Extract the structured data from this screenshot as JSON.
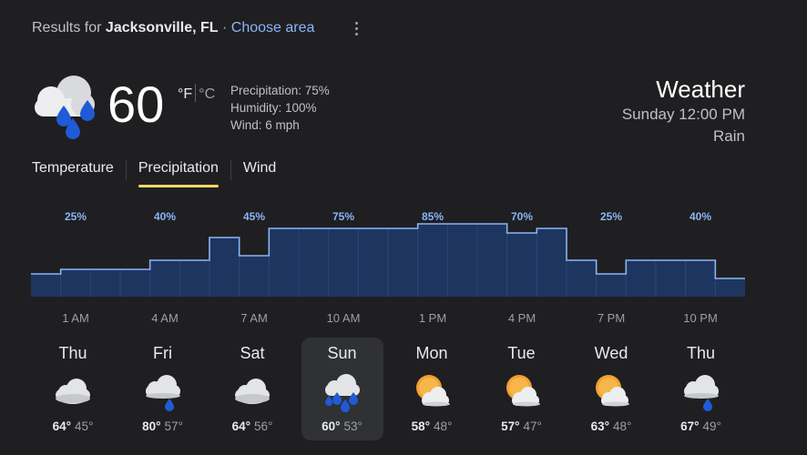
{
  "header": {
    "results_prefix": "Results for",
    "location": "Jacksonville, FL",
    "separator": "·",
    "choose_area": "Choose area"
  },
  "current": {
    "temperature": "60",
    "unit_f": "°F",
    "unit_c": "°C",
    "precipitation": "Precipitation: 75%",
    "humidity": "Humidity: 100%",
    "wind": "Wind: 6 mph",
    "icon": "rain-cloud-icon"
  },
  "summary": {
    "title": "Weather",
    "datetime": "Sunday 12:00 PM",
    "condition": "Rain"
  },
  "tabs": [
    {
      "label": "Temperature",
      "active": false
    },
    {
      "label": "Precipitation",
      "active": true
    },
    {
      "label": "Wind",
      "active": false
    }
  ],
  "chart_data": {
    "type": "bar",
    "series": [
      {
        "values": [
          25,
          30,
          30,
          30,
          40,
          40,
          65,
          45,
          75,
          75,
          75,
          75,
          75,
          80,
          80,
          80,
          70,
          75,
          40,
          25,
          40,
          40,
          40,
          20
        ]
      }
    ],
    "ylim": [
      0,
      100
    ],
    "labels": [
      {
        "text": "25%",
        "index": 1
      },
      {
        "text": "40%",
        "index": 4
      },
      {
        "text": "45%",
        "index": 7
      },
      {
        "text": "75%",
        "index": 10
      },
      {
        "text": "85%",
        "index": 13
      },
      {
        "text": "70%",
        "index": 16
      },
      {
        "text": "25%",
        "index": 19
      },
      {
        "text": "40%",
        "index": 22
      }
    ],
    "x_labels": [
      "1 AM",
      "4 AM",
      "7 AM",
      "10 AM",
      "1 PM",
      "4 PM",
      "7 PM",
      "10 PM"
    ],
    "colors": {
      "fill": "#1e355f",
      "stroke": "#8ab4f8",
      "label": "#8ab4f8"
    }
  },
  "days": [
    {
      "name": "Thu",
      "icon": "cloudy-icon",
      "high": "64°",
      "low": "45°",
      "selected": false
    },
    {
      "name": "Fri",
      "icon": "cloud-rain-drop-icon",
      "high": "80°",
      "low": "57°",
      "selected": false
    },
    {
      "name": "Sat",
      "icon": "cloudy-icon",
      "high": "64°",
      "low": "56°",
      "selected": false
    },
    {
      "name": "Sun",
      "icon": "rain-cloud-icon",
      "high": "60°",
      "low": "53°",
      "selected": true
    },
    {
      "name": "Mon",
      "icon": "partly-cloudy-icon",
      "high": "58°",
      "low": "48°",
      "selected": false
    },
    {
      "name": "Tue",
      "icon": "partly-cloudy-icon",
      "high": "57°",
      "low": "47°",
      "selected": false
    },
    {
      "name": "Wed",
      "icon": "partly-cloudy-icon",
      "high": "63°",
      "low": "48°",
      "selected": false
    },
    {
      "name": "Thu",
      "icon": "cloud-rain-drop-icon",
      "high": "67°",
      "low": "49°",
      "selected": false
    }
  ]
}
